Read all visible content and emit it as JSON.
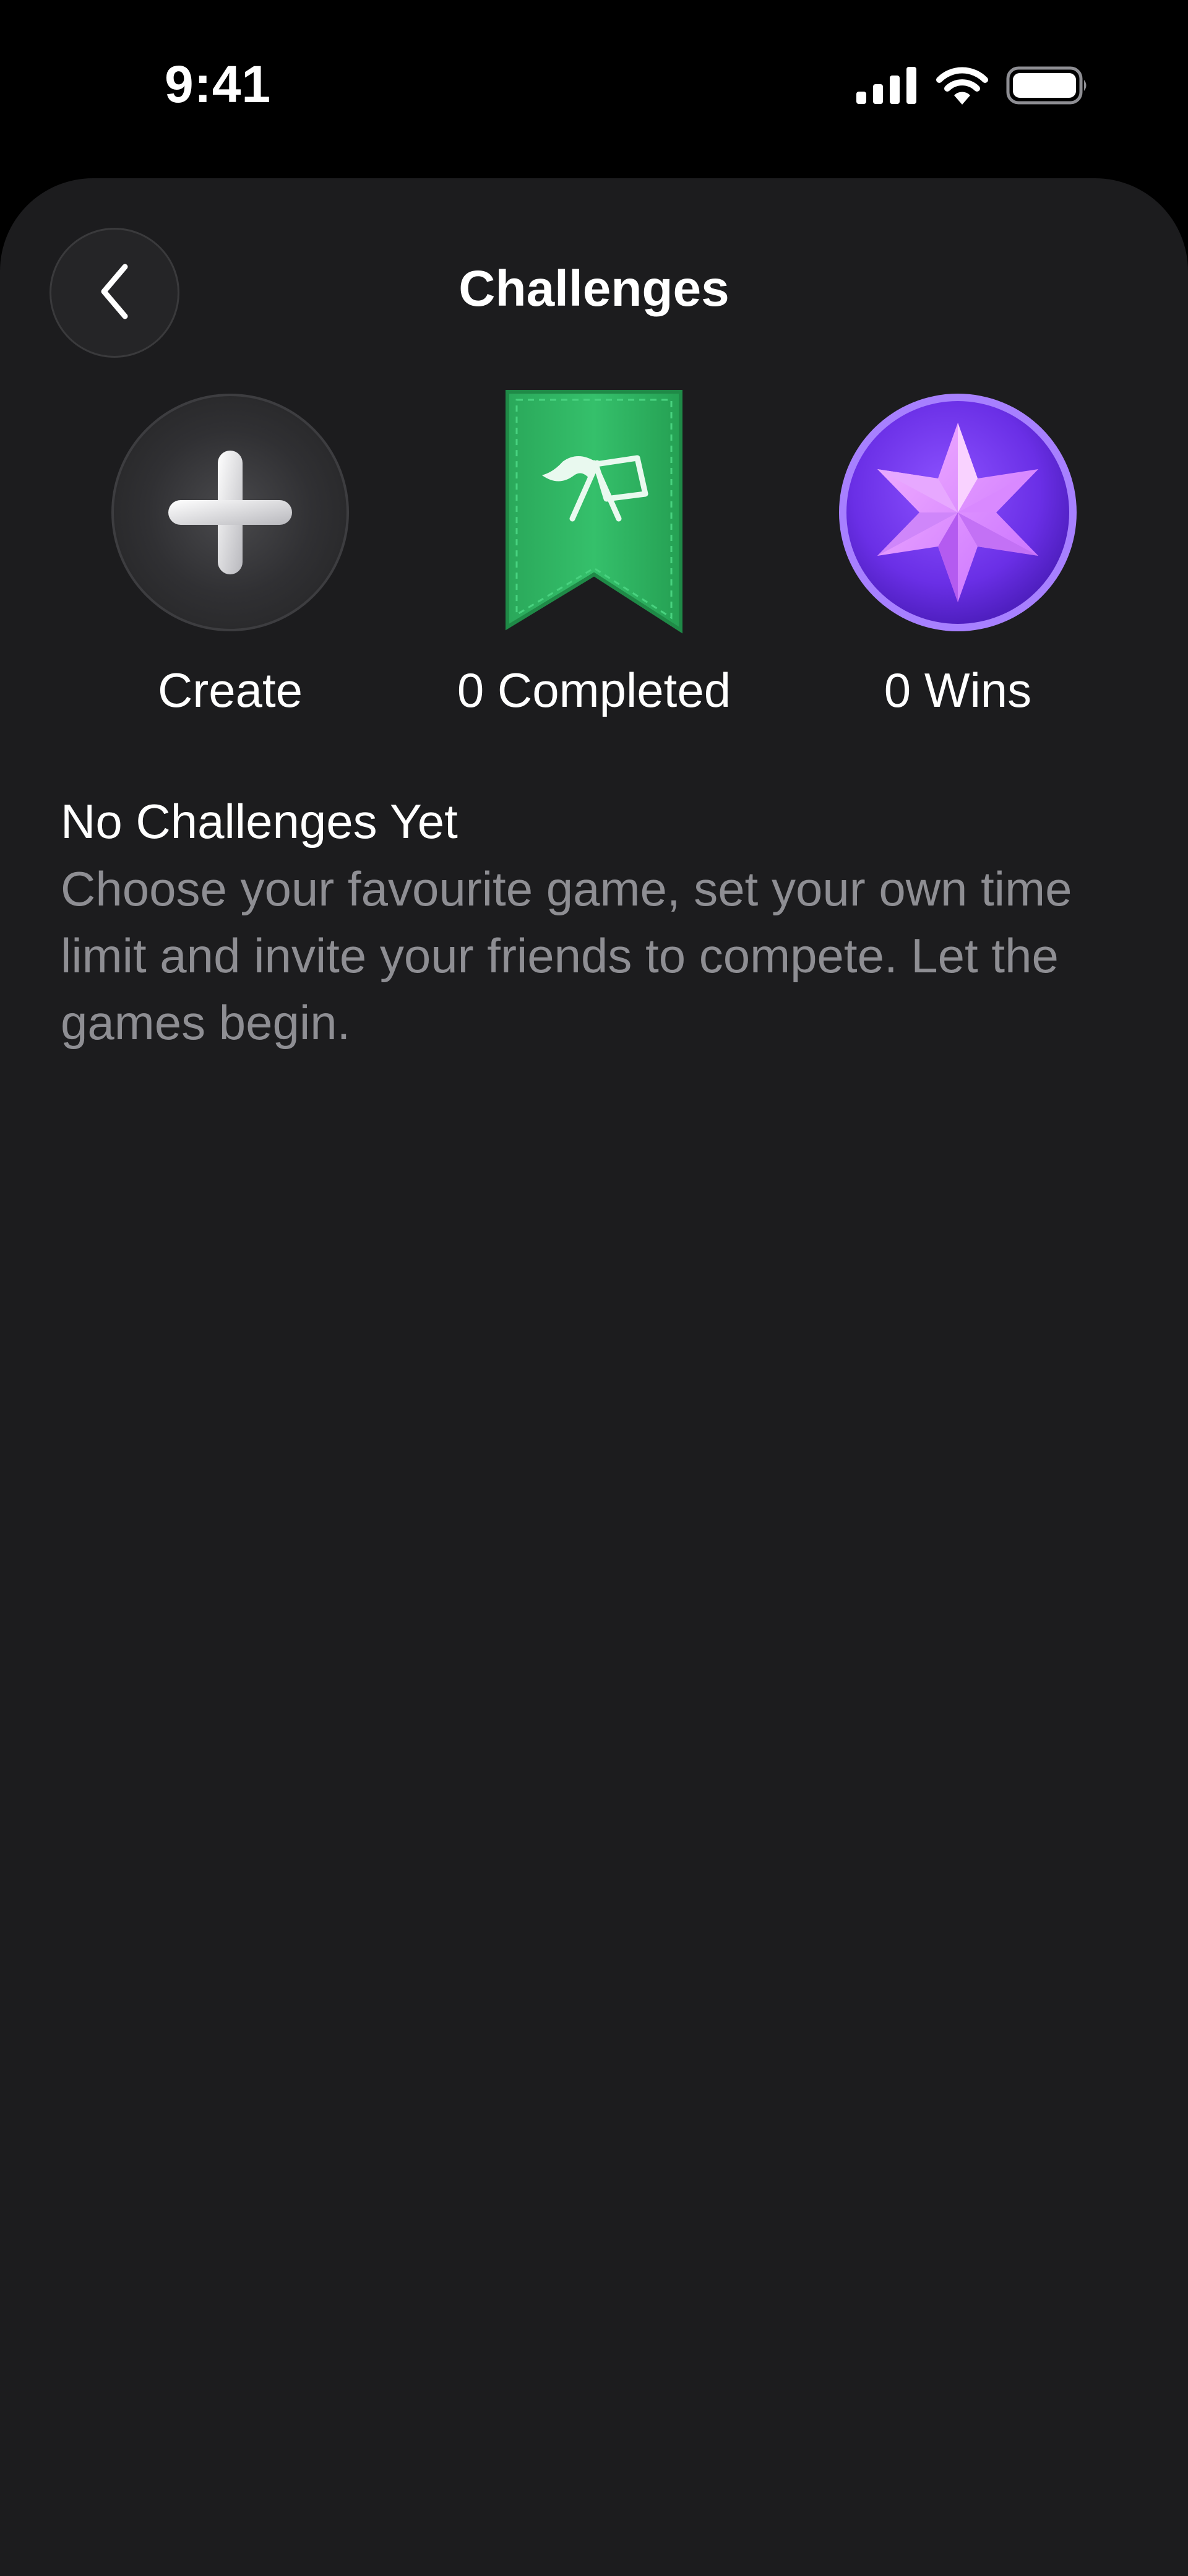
{
  "status_bar": {
    "time": "9:41",
    "icons": [
      "cellular-signal-icon",
      "wifi-icon",
      "battery-icon"
    ]
  },
  "header": {
    "title": "Challenges",
    "back_icon": "chevron-left-icon"
  },
  "tiles": [
    {
      "label": "Create",
      "icon": "plus-icon"
    },
    {
      "label": "0 Completed",
      "icon": "flags-banner-icon"
    },
    {
      "label": "0 Wins",
      "icon": "star-medal-icon"
    }
  ],
  "empty_state": {
    "title": "No Challenges Yet",
    "body": "Choose your favourite game, set your own time limit and invite your friends to compete. Let the games begin."
  },
  "colors": {
    "background": "#1c1c1e",
    "status_bar": "#000000",
    "banner_green": "#2fb865",
    "medal_purple": "#7b3cf0",
    "secondary_text": "#8e8e93"
  }
}
